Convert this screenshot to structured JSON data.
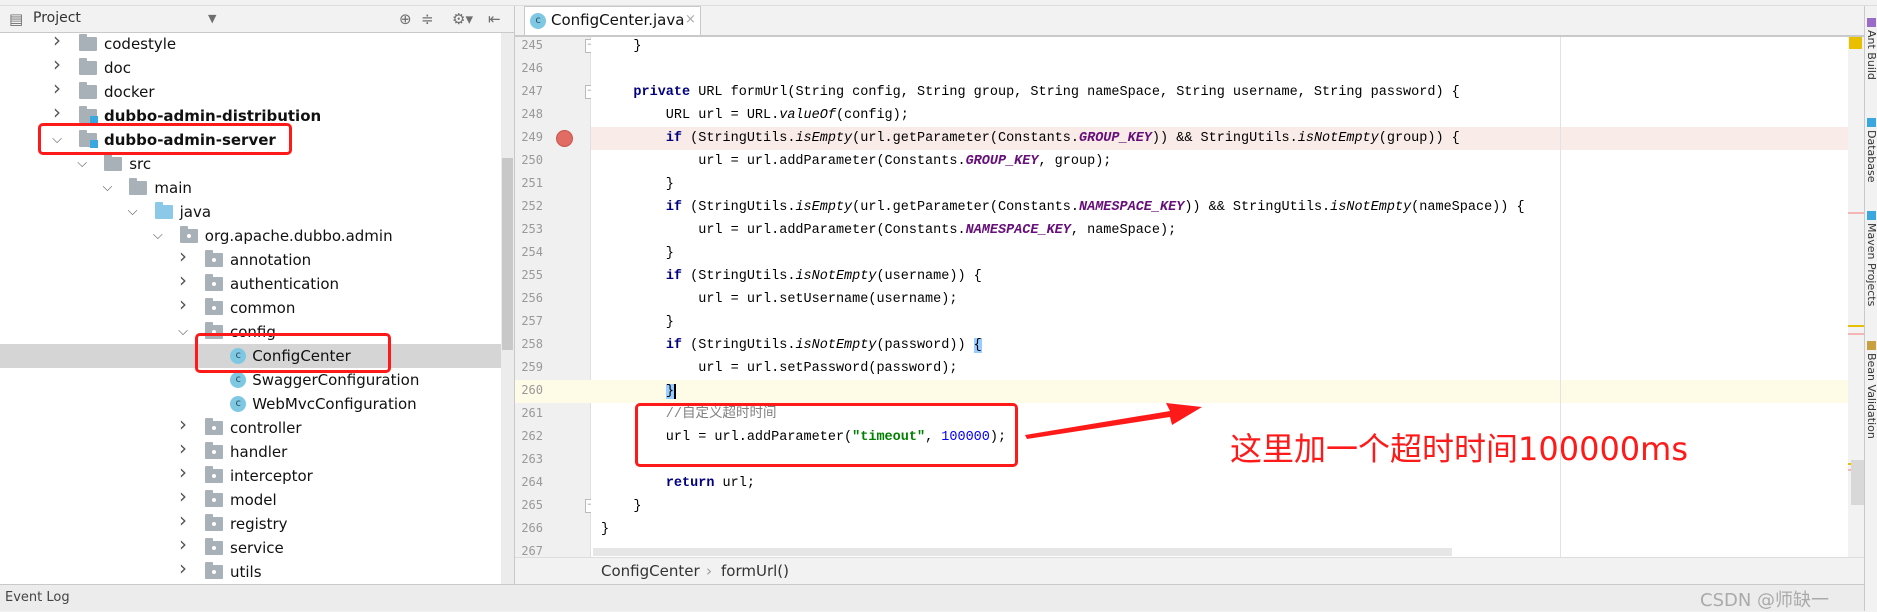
{
  "project_panel": {
    "title": "Project",
    "icons": [
      "project-view-icon",
      "dropdown-arrow-icon",
      "locate-icon",
      "collapse-all-icon",
      "gear-icon",
      "hide-panel-icon"
    ],
    "tree": [
      {
        "label": "codestyle",
        "level": 0,
        "type": "folder",
        "expanded": false
      },
      {
        "label": "doc",
        "level": 0,
        "type": "folder",
        "expanded": false
      },
      {
        "label": "docker",
        "level": 0,
        "type": "folder",
        "expanded": false
      },
      {
        "label": "dubbo-admin-distribution",
        "level": 0,
        "type": "module",
        "expanded": false,
        "bold": true
      },
      {
        "label": "dubbo-admin-server",
        "level": 0,
        "type": "module",
        "expanded": true,
        "bold": true
      },
      {
        "label": "src",
        "level": 1,
        "type": "folder",
        "expanded": true
      },
      {
        "label": "main",
        "level": 2,
        "type": "folder",
        "expanded": true
      },
      {
        "label": "java",
        "level": 3,
        "type": "source",
        "expanded": true
      },
      {
        "label": "org.apache.dubbo.admin",
        "level": 4,
        "type": "package",
        "expanded": true
      },
      {
        "label": "annotation",
        "level": 5,
        "type": "package",
        "expanded": false
      },
      {
        "label": "authentication",
        "level": 5,
        "type": "package",
        "expanded": false
      },
      {
        "label": "common",
        "level": 5,
        "type": "package",
        "expanded": false
      },
      {
        "label": "config",
        "level": 5,
        "type": "package",
        "expanded": true
      },
      {
        "label": "ConfigCenter",
        "level": 6,
        "type": "class",
        "selected": true
      },
      {
        "label": "SwaggerConfiguration",
        "level": 6,
        "type": "class"
      },
      {
        "label": "WebMvcConfiguration",
        "level": 6,
        "type": "class"
      },
      {
        "label": "controller",
        "level": 5,
        "type": "package",
        "expanded": false
      },
      {
        "label": "handler",
        "level": 5,
        "type": "package",
        "expanded": false
      },
      {
        "label": "interceptor",
        "level": 5,
        "type": "package",
        "expanded": false
      },
      {
        "label": "model",
        "level": 5,
        "type": "package",
        "expanded": false
      },
      {
        "label": "registry",
        "level": 5,
        "type": "package",
        "expanded": false
      },
      {
        "label": "service",
        "level": 5,
        "type": "package",
        "expanded": false
      },
      {
        "label": "utils",
        "level": 5,
        "type": "package",
        "expanded": false
      }
    ]
  },
  "editor": {
    "tab": {
      "label": "ConfigCenter.java",
      "icon": "class-icon",
      "close": "×"
    },
    "lines": [
      {
        "n": "245",
        "fold": true,
        "tokens": [
          [
            "",
            "    }"
          ]
        ]
      },
      {
        "n": "246",
        "tokens": []
      },
      {
        "n": "247",
        "fold": true,
        "tokens": [
          [
            "",
            "    "
          ],
          [
            "kw",
            "private"
          ],
          [
            "",
            " URL formUrl(String config, String group, String nameSpace, String username, String password) {"
          ]
        ]
      },
      {
        "n": "248",
        "tokens": [
          [
            "",
            "        URL url = URL."
          ],
          [
            "it",
            "valueOf"
          ],
          [
            "",
            "(config);"
          ]
        ]
      },
      {
        "n": "249",
        "breakpoint": true,
        "tokens": [
          [
            "",
            "        "
          ],
          [
            "kw",
            "if"
          ],
          [
            "",
            " (StringUtils."
          ],
          [
            "it",
            "isEmpty"
          ],
          [
            "",
            "(url.getParameter(Constants."
          ],
          [
            "cst",
            "GROUP_KEY"
          ],
          [
            "",
            ")) && StringUtils."
          ],
          [
            "it",
            "isNotEmpty"
          ],
          [
            "",
            "(group)) {"
          ]
        ]
      },
      {
        "n": "250",
        "tokens": [
          [
            "",
            "            url = url.addParameter(Constants."
          ],
          [
            "cst",
            "GROUP_KEY"
          ],
          [
            "",
            ", group);"
          ]
        ]
      },
      {
        "n": "251",
        "tokens": [
          [
            "",
            "        }"
          ]
        ]
      },
      {
        "n": "252",
        "tokens": [
          [
            "",
            "        "
          ],
          [
            "kw",
            "if"
          ],
          [
            "",
            " (StringUtils."
          ],
          [
            "it",
            "isEmpty"
          ],
          [
            "",
            "(url.getParameter(Constants."
          ],
          [
            "cst",
            "NAMESPACE_KEY"
          ],
          [
            "",
            ")) && StringUtils."
          ],
          [
            "it",
            "isNotEmpty"
          ],
          [
            "",
            "(nameSpace)) {"
          ]
        ]
      },
      {
        "n": "253",
        "tokens": [
          [
            "",
            "            url = url.addParameter(Constants."
          ],
          [
            "cst",
            "NAMESPACE_KEY"
          ],
          [
            "",
            ", nameSpace);"
          ]
        ]
      },
      {
        "n": "254",
        "tokens": [
          [
            "",
            "        }"
          ]
        ]
      },
      {
        "n": "255",
        "tokens": [
          [
            "",
            "        "
          ],
          [
            "kw",
            "if"
          ],
          [
            "",
            " (StringUtils."
          ],
          [
            "it",
            "isNotEmpty"
          ],
          [
            "",
            "(username)) {"
          ]
        ]
      },
      {
        "n": "256",
        "tokens": [
          [
            "",
            "            url = url.setUsername(username);"
          ]
        ]
      },
      {
        "n": "257",
        "tokens": [
          [
            "",
            "        }"
          ]
        ]
      },
      {
        "n": "258",
        "tokens": [
          [
            "",
            "        "
          ],
          [
            "kw",
            "if"
          ],
          [
            "",
            " (StringUtils."
          ],
          [
            "it",
            "isNotEmpty"
          ],
          [
            "",
            "(password)) "
          ],
          [
            "match",
            "{"
          ]
        ]
      },
      {
        "n": "259",
        "tokens": [
          [
            "",
            "            url = url.setPassword(password);"
          ]
        ]
      },
      {
        "n": "260",
        "current": true,
        "tokens": [
          [
            "",
            "        "
          ],
          [
            "match caret",
            "}"
          ]
        ]
      },
      {
        "n": "261",
        "tokens": [
          [
            "cm",
            "        //自定义超时时间"
          ]
        ]
      },
      {
        "n": "262",
        "tokens": [
          [
            "",
            "        url = url.addParameter("
          ],
          [
            "str",
            "\"timeout\""
          ],
          [
            "",
            ", "
          ],
          [
            "num",
            "100000"
          ],
          [
            "",
            ");"
          ]
        ]
      },
      {
        "n": "263",
        "tokens": []
      },
      {
        "n": "264",
        "tokens": [
          [
            "",
            "        "
          ],
          [
            "kw",
            "return"
          ],
          [
            "",
            " url;"
          ]
        ]
      },
      {
        "n": "265",
        "fold": true,
        "tokens": [
          [
            "",
            "    }"
          ]
        ]
      },
      {
        "n": "266",
        "tokens": [
          [
            "",
            "}"
          ]
        ]
      },
      {
        "n": "267",
        "tokens": []
      }
    ],
    "breadcrumb": [
      "ConfigCenter",
      "formUrl()"
    ],
    "breadcrumb_sep": "›"
  },
  "right_tool_windows": [
    {
      "label": "Ant Build",
      "color": "#9b6bc8"
    },
    {
      "label": "Database",
      "color": "#3aa8de"
    },
    {
      "label": "Maven Projects",
      "color": "#3aa8de"
    },
    {
      "label": "Bean Validation",
      "color": "#c9a040"
    }
  ],
  "status_bar": {
    "event_log": "Event Log"
  },
  "annotation": {
    "text": "这里加一个超时时间100000ms",
    "color": "#ff1a1a"
  },
  "watermark": "CSDN @师缺一",
  "colors": {
    "breakpoint_line": "#f9ebe8",
    "current_line": "#fefbe6",
    "keyword": "#000080",
    "constant": "#660e7a",
    "string": "#008000",
    "number": "#0000ff",
    "highlight_box": "#ff1a1a"
  }
}
